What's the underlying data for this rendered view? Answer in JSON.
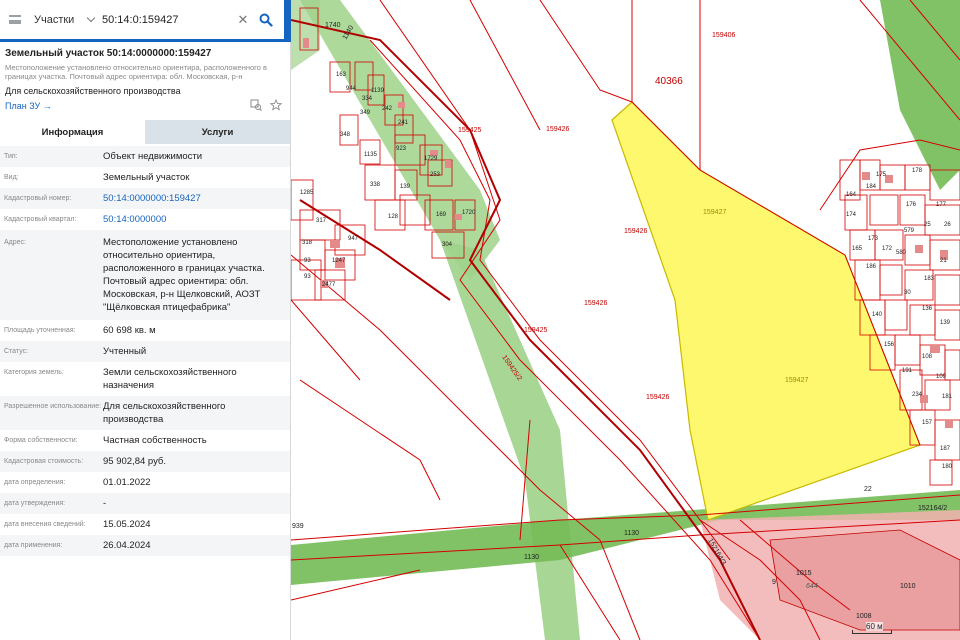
{
  "search": {
    "type_label": "Участки",
    "query": "50:14:0:159427"
  },
  "parcel": {
    "title": "Земельный участок 50:14:0000000:159427",
    "location_short": "Местоположение установлено относительно ориентира, расположенного в границах участка. Почтовый адрес ориентира: обл. Московская, р-н",
    "purpose": "Для сельскохозяйственного производства",
    "plan_link": "План ЗУ →"
  },
  "tabs": [
    {
      "label": "Информация",
      "active": true
    },
    {
      "label": "Услуги",
      "active": false
    }
  ],
  "info": [
    {
      "label": "Тип:",
      "value": "Объект недвижимости"
    },
    {
      "label": "Вид:",
      "value": "Земельный участок"
    },
    {
      "label": "Кадастровый номер:",
      "value": "50:14:0000000:159427",
      "link": true
    },
    {
      "label": "Кадастровый квартал:",
      "value": "50:14:0000000",
      "link": true
    },
    {
      "label": "Адрес:",
      "value": "Местоположение установлено относительно ориентира, расположенного в границах участка. Почтовый адрес ориентира: обл. Московская, р-н Щелковский, АОЗТ \"Щёлковская птицефабрика\""
    },
    {
      "label": "Площадь уточненная:",
      "value": "60 698 кв. м"
    },
    {
      "label": "Статус:",
      "value": "Учтенный"
    },
    {
      "label": "Категория земель:",
      "value": "Земли сельскохозяйственного назначения"
    },
    {
      "label": "Разрешенное использование:",
      "value": "Для сельскохозяйственного производства"
    },
    {
      "label": "Форма собственности:",
      "value": "Частная собственность"
    },
    {
      "label": "Кадастровая стоимость:",
      "value": "95 902,84 руб."
    },
    {
      "label": "дата определения:",
      "value": "01.01.2022"
    },
    {
      "label": "дата утверждения:",
      "value": "-"
    },
    {
      "label": "дата внесения сведений:",
      "value": "15.05.2024"
    },
    {
      "label": "дата применения:",
      "value": "26.04.2024"
    }
  ],
  "map": {
    "parcel_labels": [
      "159406",
      "40366",
      "159425",
      "159426",
      "159427",
      "159426",
      "159426",
      "159425",
      "159426",
      "159427",
      "1740",
      "1140",
      "159425/2",
      "1130",
      "1130",
      "22",
      "152164/2",
      "152164/3",
      "1015",
      "1010",
      "939",
      "644",
      "9"
    ],
    "small_labels": [
      "163",
      "944",
      "334",
      "1139",
      "242",
      "241",
      "349",
      "348",
      "923",
      "1729",
      "253",
      "139",
      "1135",
      "338",
      "128",
      "169",
      "1720",
      "304",
      "1285",
      "317",
      "947",
      "1247",
      "318",
      "93",
      "2477",
      "93",
      "178",
      "175",
      "184",
      "164",
      "176",
      "177",
      "25",
      "174",
      "173",
      "579",
      "26",
      "165",
      "172",
      "580",
      "21",
      "186",
      "183",
      "30",
      "136",
      "139",
      "140",
      "108",
      "156",
      "109",
      "191",
      "234",
      "181",
      "157",
      "187",
      "180"
    ],
    "scale_label": "60 м",
    "scale_num": "1008",
    "colors": {
      "boundary": "#d40000",
      "selected_fill": "#fdf86d",
      "selected_stroke": "#c9b800",
      "green_fill": "#74bb55",
      "green_light": "#9fd28a",
      "building_fill": "#f2b2b2",
      "label_red": "#c00000"
    }
  }
}
